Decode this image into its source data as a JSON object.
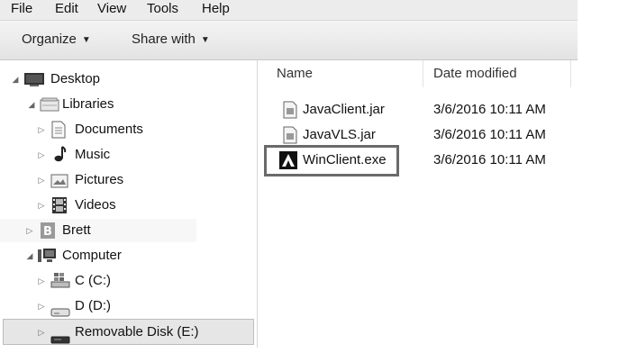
{
  "menu": {
    "items": [
      "File",
      "Edit",
      "View",
      "Tools",
      "Help"
    ]
  },
  "toolbar": {
    "organize_label": "Organize",
    "share_label": "Share with",
    "caret": "▼"
  },
  "nav": {
    "desktop": "Desktop",
    "libraries": "Libraries",
    "documents": "Documents",
    "music": "Music",
    "pictures": "Pictures",
    "videos": "Videos",
    "user": "Brett",
    "computer": "Computer",
    "drive_c": "C (C:)",
    "drive_d": "D (D:)",
    "drive_e": "Removable Disk (E:)",
    "expanded_glyph": "◢",
    "collapsed_glyph": "▷"
  },
  "content": {
    "columns": {
      "name": "Name",
      "date": "Date modified"
    },
    "files": [
      {
        "name": "JavaClient.jar",
        "date": "3/6/2016 10:11 AM",
        "icon": "jar-file-icon"
      },
      {
        "name": "JavaVLS.jar",
        "date": "3/6/2016 10:11 AM",
        "icon": "jar-file-icon"
      },
      {
        "name": "WinClient.exe",
        "date": "3/6/2016 10:11 AM",
        "icon": "app-logo-icon"
      }
    ]
  }
}
